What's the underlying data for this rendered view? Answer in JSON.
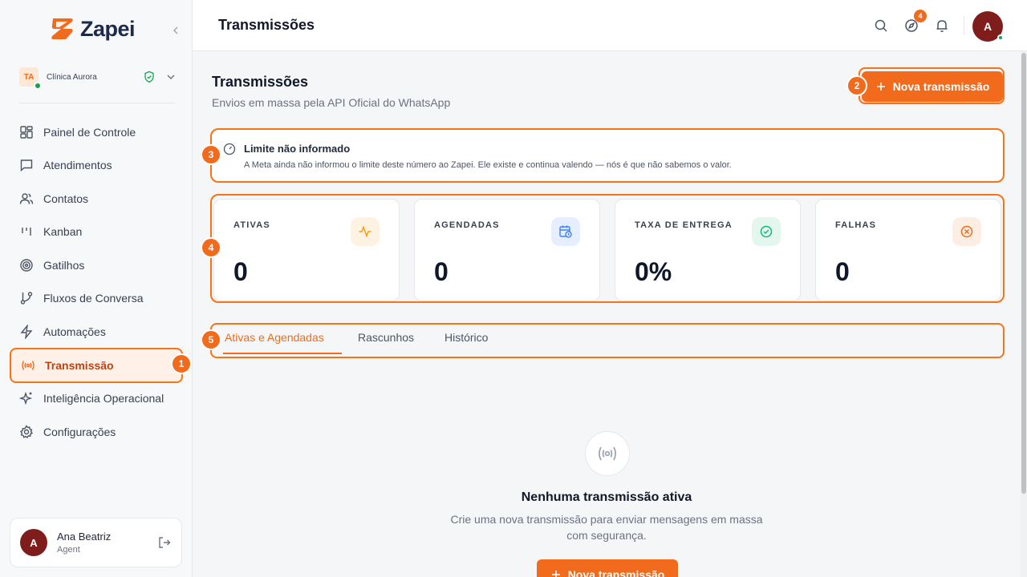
{
  "brand": {
    "name": "Zapei",
    "accent": "#f26a1b"
  },
  "workspace": {
    "initials": "TA",
    "name": "Clínica Aurora"
  },
  "sidebar": {
    "items": [
      {
        "label": "Painel de Controle"
      },
      {
        "label": "Atendimentos"
      },
      {
        "label": "Contatos"
      },
      {
        "label": "Kanban"
      },
      {
        "label": "Gatilhos"
      },
      {
        "label": "Fluxos de Conversa"
      },
      {
        "label": "Automações"
      },
      {
        "label": "Transmissão"
      },
      {
        "label": "Inteligência Operacional"
      },
      {
        "label": "Configurações"
      }
    ]
  },
  "user": {
    "initial": "A",
    "name": "Ana Beatriz",
    "role": "Agent"
  },
  "header": {
    "title": "Transmissões",
    "notification_count": "4",
    "avatar_initial": "A"
  },
  "page": {
    "title": "Transmissões",
    "subtitle": "Envios em massa pela API Oficial do WhatsApp",
    "new_button": "Nova transmissão"
  },
  "limit": {
    "title": "Limite não informado",
    "description": "A Meta ainda não informou o limite deste número ao Zapei. Ele existe e continua valendo — nós é que não sabemos o valor."
  },
  "stats": [
    {
      "label": "ATIVAS",
      "value": "0",
      "color": "#f59e0b"
    },
    {
      "label": "AGENDADAS",
      "value": "0",
      "color": "#3b82f6"
    },
    {
      "label": "TAXA DE ENTREGA",
      "value": "0%",
      "color": "#10b981"
    },
    {
      "label": "FALHAS",
      "value": "0",
      "color": "#f26a1b"
    }
  ],
  "tabs": [
    {
      "label": "Ativas e Agendadas"
    },
    {
      "label": "Rascunhos"
    },
    {
      "label": "Histórico"
    }
  ],
  "empty": {
    "title": "Nenhuma transmissão ativa",
    "description": "Crie uma nova transmissão para enviar mensagens em massa com segurança.",
    "button": "Nova transmissão"
  },
  "steps": [
    "1",
    "2",
    "3",
    "4",
    "5"
  ]
}
